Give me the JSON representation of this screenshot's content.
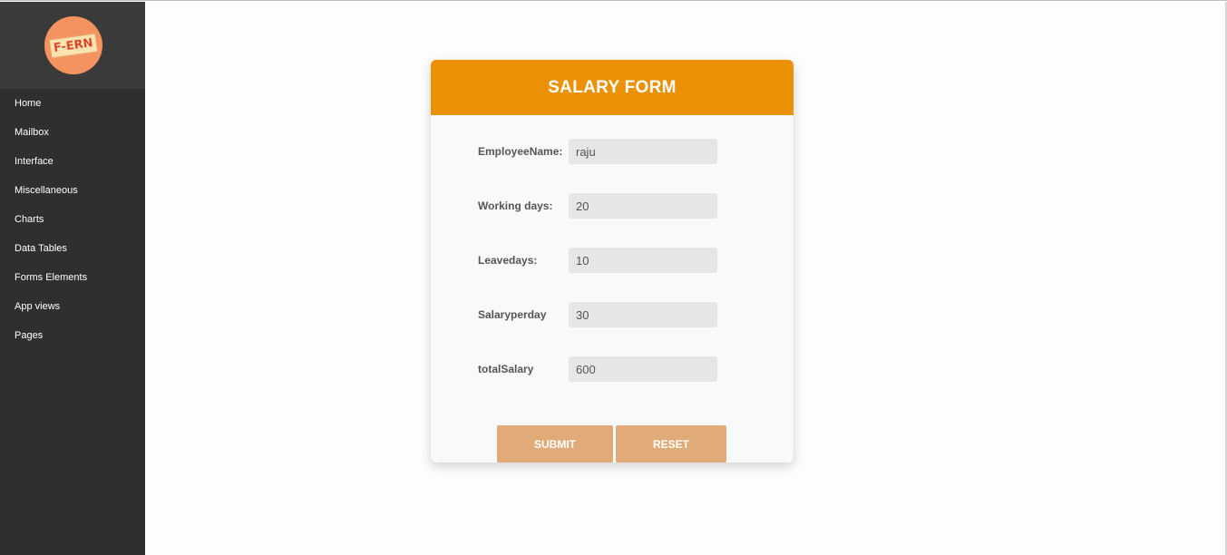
{
  "sidebar": {
    "logo_text": "F-ERN",
    "items": [
      {
        "label": "Home"
      },
      {
        "label": "Mailbox"
      },
      {
        "label": "Interface"
      },
      {
        "label": "Miscellaneous"
      },
      {
        "label": "Charts"
      },
      {
        "label": "Data Tables"
      },
      {
        "label": "Forms Elements"
      },
      {
        "label": "App views"
      },
      {
        "label": "Pages"
      }
    ]
  },
  "form": {
    "title": "SALARY FORM",
    "fields": [
      {
        "label": "EmployeeName:",
        "value": "raju"
      },
      {
        "label": "Working days:",
        "value": "20"
      },
      {
        "label": "Leavedays:",
        "value": "10"
      },
      {
        "label": "Salaryperday",
        "value": "30"
      },
      {
        "label": "totalSalary",
        "value": "600"
      }
    ],
    "submit_label": "SUBMIT",
    "reset_label": "RESET"
  },
  "colors": {
    "header": "#ec9006",
    "button": "#e0ab78",
    "sidebar": "#2f2f2f"
  }
}
